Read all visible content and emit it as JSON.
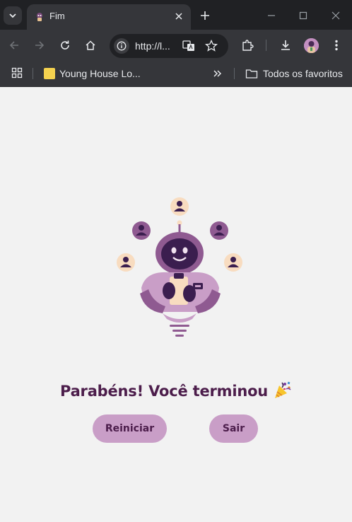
{
  "browser": {
    "tab": {
      "title": "Fim"
    },
    "address": {
      "url": "http://l..."
    },
    "bookmarks": {
      "item1": "Young House Lo...",
      "all_bookmarks": "Todos os favoritos"
    }
  },
  "page": {
    "heading": "Parabéns! Você terminou",
    "buttons": {
      "restart": "Reiniciar",
      "exit": "Sair"
    }
  },
  "colors": {
    "accent_button": "#c99ec7",
    "heading_text": "#4c1d4b",
    "robot_purple": "#8f5a91",
    "robot_dark": "#3b1e4f",
    "person_bubble": "#f8dcc0",
    "page_bg": "#f2f2f2"
  }
}
